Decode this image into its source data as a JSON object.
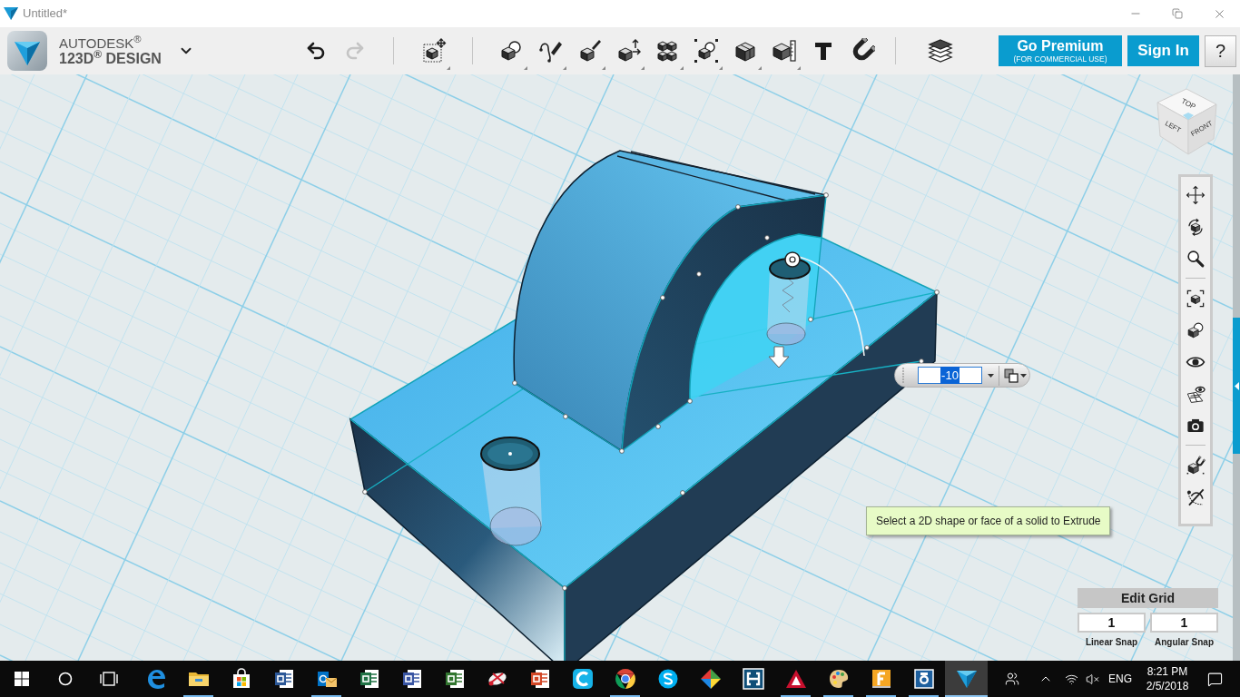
{
  "window": {
    "title": "Untitled*"
  },
  "brand": {
    "company": "AUTODESK$^{®}$",
    "product": "123D$^{®}$ DESIGN"
  },
  "history": {
    "undo": {
      "disabled": false
    },
    "redo": {
      "disabled": true
    }
  },
  "account": {
    "premium": {
      "label": "Go Premium",
      "note": "(FOR COMMERCIAL USE)"
    },
    "sign_in": "Sign In",
    "help": "?"
  },
  "view_cube": {
    "faces": [
      "TOP",
      "LEFT",
      "FRONT"
    ]
  },
  "extrude_input": {
    "value": "-10",
    "highlighted": true
  },
  "hint": "Select a 2D shape or face of a solid to Extrude",
  "edit_grid": {
    "title": "Edit Grid",
    "fields": [
      {
        "value": "1",
        "label": "Linear Snap"
      },
      {
        "value": "1",
        "label": "Angular Snap"
      }
    ]
  },
  "taskbar": {
    "apps": [
      {
        "kind": "edge",
        "running": false,
        "active": false
      },
      {
        "kind": "folder",
        "running": true,
        "active": false
      },
      {
        "kind": "store",
        "running": false,
        "active": false
      },
      {
        "kind": "word",
        "running": false,
        "active": false
      },
      {
        "kind": "outlook",
        "running": true,
        "active": false
      },
      {
        "kind": "excel",
        "running": false,
        "active": false
      },
      {
        "kind": "visio",
        "running": false,
        "active": false
      },
      {
        "kind": "project",
        "running": false,
        "active": false
      },
      {
        "kind": "scissors",
        "running": false,
        "active": false
      },
      {
        "kind": "powerpoint",
        "running": false,
        "active": false
      },
      {
        "kind": "arc",
        "running": false,
        "active": false
      },
      {
        "kind": "chrome",
        "running": true,
        "active": false
      },
      {
        "kind": "skype",
        "running": false,
        "active": false
      },
      {
        "kind": "diamond",
        "running": false,
        "active": false
      },
      {
        "kind": "bracket",
        "running": false,
        "active": false
      },
      {
        "kind": "autocad",
        "running": true,
        "active": false
      },
      {
        "kind": "palette",
        "running": true,
        "active": false
      },
      {
        "kind": "fusion",
        "running": true,
        "active": false
      },
      {
        "kind": "capture",
        "running": true,
        "active": false
      },
      {
        "kind": "design",
        "running": true,
        "active": true
      }
    ],
    "language": "ENG",
    "time": "8:21 PM",
    "date": "2/5/2018"
  }
}
